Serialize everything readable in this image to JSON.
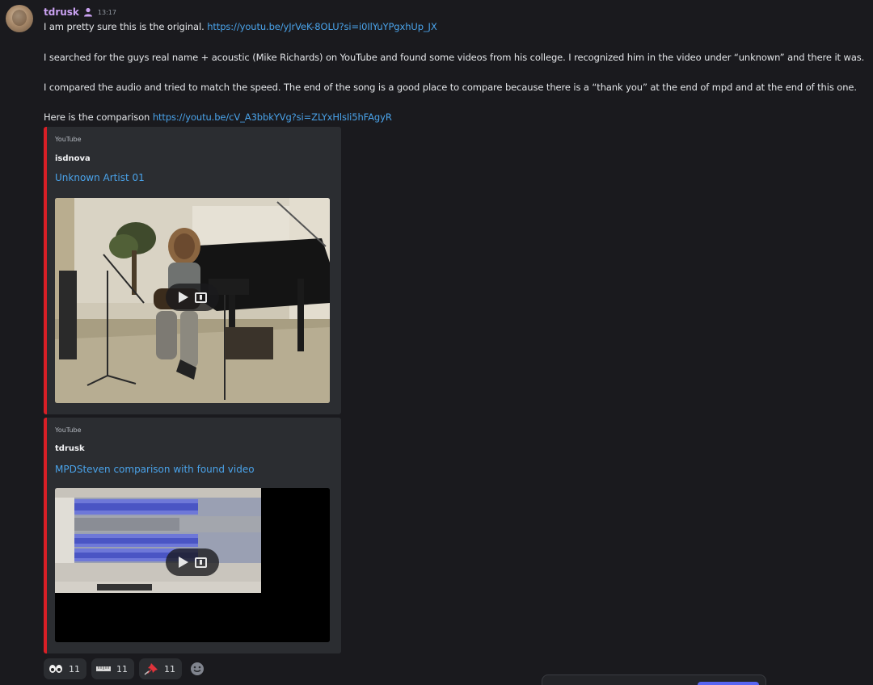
{
  "message": {
    "username": "tdrusk",
    "timestamp": "13:17",
    "lines": [
      {
        "text": "I am pretty sure this is the original.",
        "link": "https://youtu.be/yJrVeK-8OLU?si=i0IlYuYPgxhUp_JX"
      },
      {
        "text": "I searched for the guys real name + acoustic (Mike Richards) on YouTube and found some videos from his college. I recognized him in the video under “unknown” and there it was.",
        "link": ""
      },
      {
        "text": "I compared the audio and tried to match the speed. The end of the song is a good place to compare because there is a “thank you” at the end of mpd and at the end of this one.",
        "link": ""
      },
      {
        "text": "Here is the comparison",
        "link": "https://youtu.be/cV_A3bbkYVg?si=ZLYxHlsIi5hFAgyR"
      }
    ]
  },
  "embeds": [
    {
      "provider": "YouTube",
      "author": "isdnova",
      "title": "Unknown Artist 01"
    },
    {
      "provider": "YouTube",
      "author": "tdrusk",
      "title": "MPDSteven comparison with found video"
    }
  ],
  "reactions": [
    {
      "icon": "eyes-icon",
      "count": "11"
    },
    {
      "icon": "ruler-icon",
      "count": "11"
    },
    {
      "icon": "pushpin-icon",
      "count": "11"
    }
  ],
  "colors": {
    "username": "#c9a1f0",
    "link": "#4aa3ea",
    "embed_border": "#d81f26"
  }
}
